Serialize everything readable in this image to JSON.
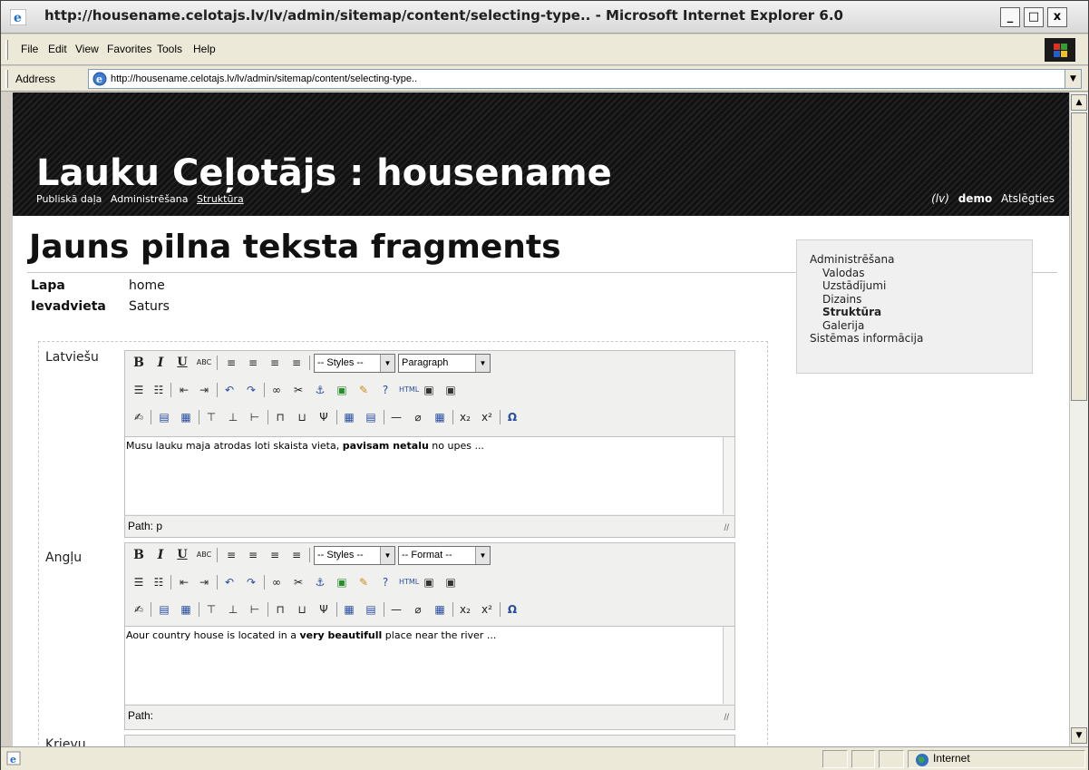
{
  "window": {
    "title": "http://housename.celotajs.lv/lv/admin/sitemap/content/selecting-type.. - Microsoft Internet Explorer 6.0",
    "minimize": "_",
    "maximize": "□",
    "close": "x"
  },
  "menu": {
    "items": [
      "File",
      "Edit",
      "View",
      "Favorites",
      "Tools",
      "Help"
    ]
  },
  "address": {
    "label": "Address",
    "url": "http://housename.celotajs.lv/lv/admin/sitemap/content/selecting-type.."
  },
  "site": {
    "title": "Lauku Ceļotājs : housename",
    "nav": [
      "Publiskā daļa",
      "Administrēšana",
      "Struktūra"
    ],
    "lang": "(lv)",
    "user": "demo",
    "logout": "Atslēgties"
  },
  "page": {
    "title": "Jauns pilna teksta fragments",
    "meta": [
      {
        "key": "Lapa",
        "value": "home"
      },
      {
        "key": "Ievadvieta",
        "value": "Saturs"
      }
    ]
  },
  "sidebar": {
    "items": [
      {
        "label": "Administrēšana"
      },
      {
        "label": "Valodas"
      },
      {
        "label": "Uzstādījumi"
      },
      {
        "label": "Dizains"
      },
      {
        "label": "Struktūra"
      },
      {
        "label": "Galerija"
      },
      {
        "label": "Sistēmas informācija"
      }
    ]
  },
  "editors": [
    {
      "language": "Latviešu",
      "styles": "-- Styles --",
      "format": "Paragraph",
      "content_pre": "Musu lauku maja atrodas loti skaista vieta, ",
      "content_bold": "pavisam netalu",
      "content_post": " no upes ...",
      "path": "Path: p"
    },
    {
      "language": "Angļu",
      "styles": "-- Styles --",
      "format": "-- Format --",
      "content_pre": "Aour country house is located in a ",
      "content_bold": "very beautifull",
      "content_post": " place near the river ...",
      "path": "Path:"
    },
    {
      "language": "Krievu"
    }
  ],
  "toolbar_icons": {
    "bold": "B",
    "italic": "I",
    "underline": "U",
    "strike": "ABC",
    "superscript_label": "x²",
    "subscript_label": "x₂",
    "omega": "Ω",
    "html": "HTML"
  },
  "status": {
    "zone": "Internet"
  }
}
